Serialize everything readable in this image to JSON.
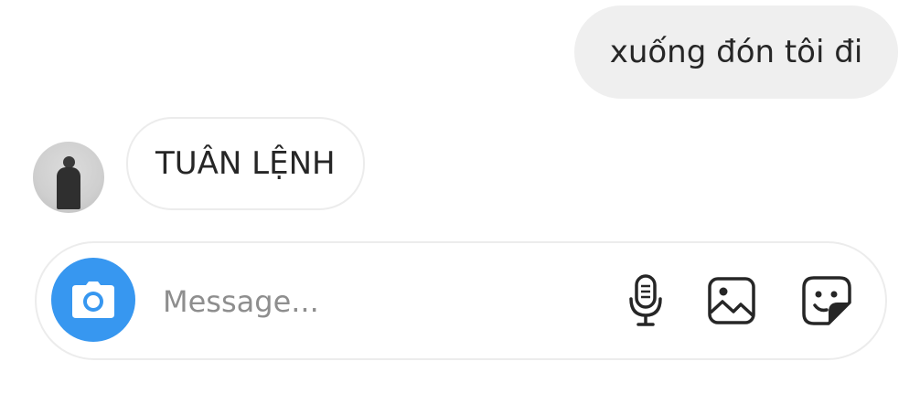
{
  "conversation": {
    "outgoing_message": "xuống đón tôi đi",
    "incoming_message": "TUÂN LỆNH"
  },
  "composer": {
    "placeholder": "Message...",
    "value": ""
  },
  "icons": {
    "camera": "camera-icon",
    "microphone": "microphone-icon",
    "gallery": "image-gallery-icon",
    "sticker": "sticker-icon"
  },
  "colors": {
    "accent": "#3797f0",
    "outgoing_bubble": "#efefef",
    "text": "#262626",
    "placeholder": "#8e8e8e"
  }
}
